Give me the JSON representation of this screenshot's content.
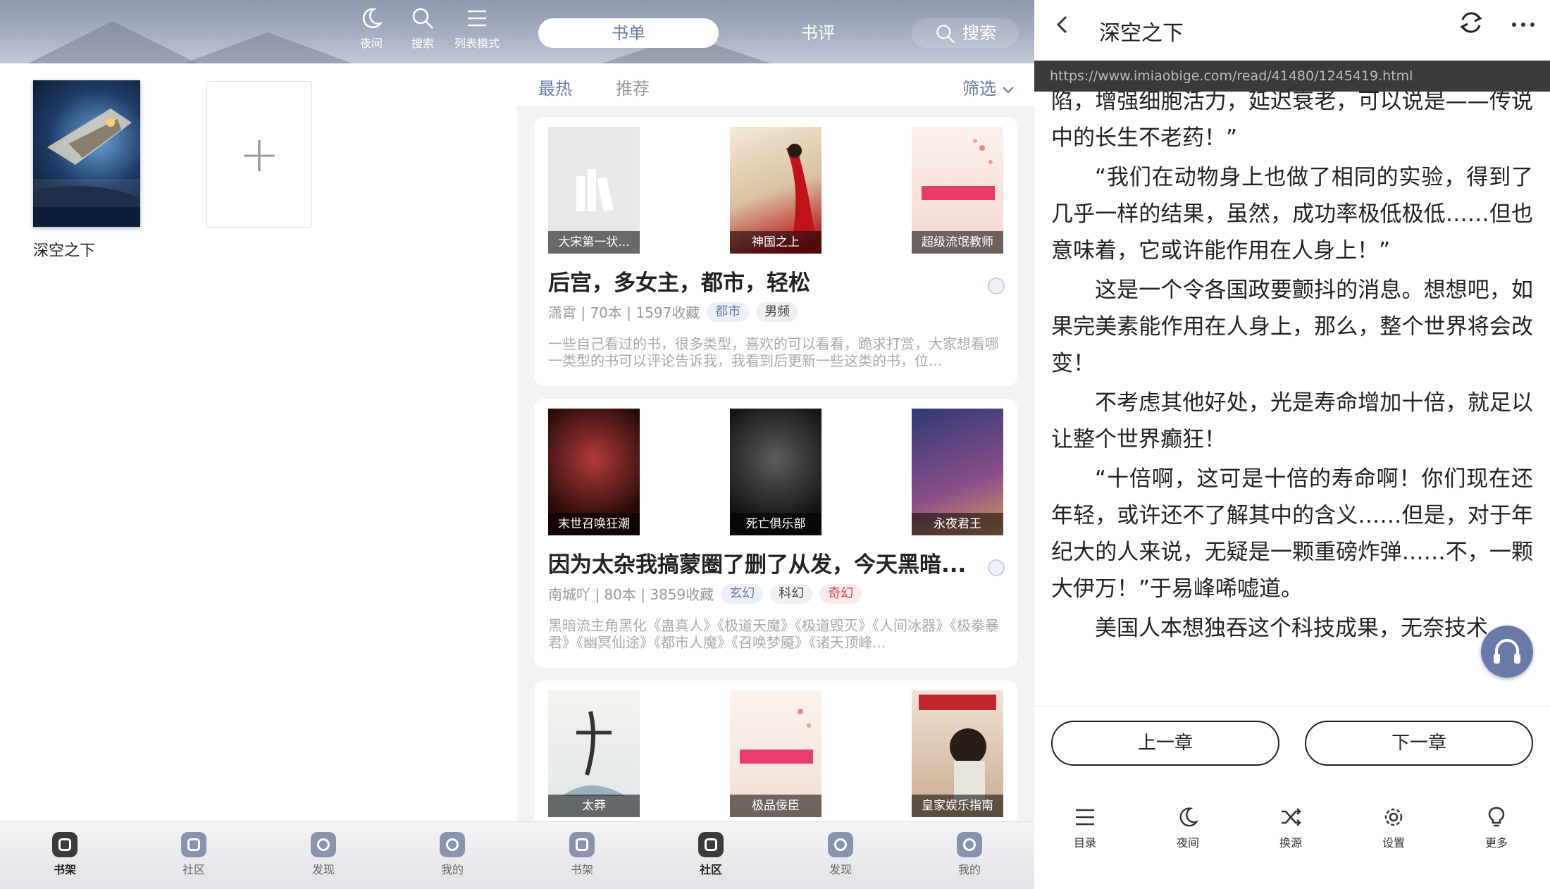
{
  "shelf": {
    "toolbar": {
      "night": "夜间",
      "search": "搜索",
      "list_mode": "列表模式"
    },
    "books": [
      {
        "title": "深空之下"
      }
    ],
    "add_symbol": "+",
    "nav": [
      "书架",
      "社区",
      "发现",
      "我的"
    ]
  },
  "community": {
    "segments": {
      "booklist": "书单",
      "review": "书评",
      "search": "搜索"
    },
    "subtabs": {
      "hot": "最热",
      "recommend": "推荐",
      "filter": "筛选"
    },
    "cards": [
      {
        "covers": [
          "大宋第一状...",
          "神国之上",
          "超级流氓教师"
        ],
        "title": "后宫，多女主，都市，轻松",
        "meta": "潇霄 | 70本 | 1597收藏",
        "tags": [
          {
            "label": "都市",
            "color": "#6a79a8",
            "bg": "#eef0f8"
          },
          {
            "label": "男频",
            "color": "#444",
            "bg": "#f0f0f0"
          }
        ],
        "desc": "一些自己看过的书，很多类型，喜欢的可以看看，跪求打赏，大家想看哪一类型的书可以评论告诉我，我看到后更新一些这类的书，位..."
      },
      {
        "covers": [
          "末世召唤狂潮",
          "死亡俱乐部",
          "永夜君王"
        ],
        "title": "因为太杂我搞蒙圈了删了从发，今天黑暗...",
        "meta": "南城吖 | 80本 | 3859收藏",
        "tags": [
          {
            "label": "玄幻",
            "color": "#6a79a8",
            "bg": "#eef0f8"
          },
          {
            "label": "科幻",
            "color": "#444",
            "bg": "#f0f0f0"
          },
          {
            "label": "奇幻",
            "color": "#d04a4a",
            "bg": "#fbeaea"
          }
        ],
        "desc": "黑暗流主角黑化《蛊真人》《极道天魔》《极道毁灭》《人间冰器》《极拳暴君》《幽冥仙途》《都市人魔》《召唤梦魇》《诸天顶峰..."
      },
      {
        "covers": [
          "太莽",
          "极品佞臣",
          "皇家娱乐指南"
        ]
      }
    ],
    "nav": [
      "书架",
      "社区",
      "发现",
      "我的"
    ]
  },
  "reader": {
    "title": "深空之下",
    "url": "https://www.imiaobige.com/read/41480/1245419.html",
    "paragraphs": [
      {
        "text": "陷，增强细胞活力，延迟衰老，可以说是——传说中的长生不老药！”",
        "indent": false
      },
      {
        "text": "“我们在动物身上也做了相同的实验，得到了几乎一样的结果，虽然，成功率极低极低……但也意味着，它或许能作用在人身上！”",
        "indent": true
      },
      {
        "text": "这是一个令各国政要颤抖的消息。想想吧，如果完美素能作用在人身上，那么，整个世界将会改变！",
        "indent": true
      },
      {
        "text": "不考虑其他好处，光是寿命增加十倍，就足以让整个世界癫狂！",
        "indent": true
      },
      {
        "text": "“十倍啊，这可是十倍的寿命啊！你们现在还年轻，或许还不了解其中的含义……但是，对于年纪大的人来说，无疑是一颗重磅炸弹……不，一颗大伊万！”于易峰唏嘘道。",
        "indent": true
      },
      {
        "text": "美国人本想独吞这个科技成果，无奈技术",
        "indent": true
      }
    ],
    "prev_chapter": "上一章",
    "next_chapter": "下一章",
    "tools": [
      "目录",
      "夜间",
      "换源",
      "设置",
      "更多"
    ]
  }
}
